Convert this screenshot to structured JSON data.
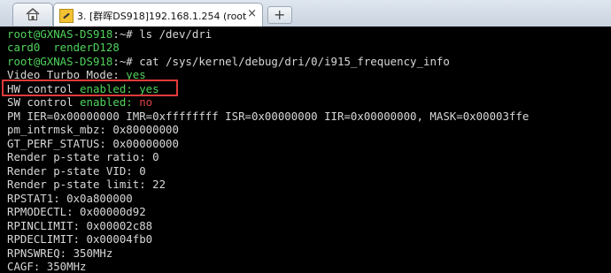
{
  "tabs": {
    "home_icon": "home-icon",
    "session_title": "3. [群晖DS918]192.168.1.254 (root)",
    "close_glyph": "×",
    "new_tab_glyph": "+"
  },
  "terminal": {
    "lines": [
      {
        "prompt": "root@GXNAS-DS918",
        "sep": ":~#",
        "cmd": " ls /dev/dri"
      },
      {
        "out": "card0  renderD128",
        "color": "green"
      },
      {
        "prompt": "root@GXNAS-DS918",
        "sep": ":~#",
        "cmd": " cat /sys/kernel/debug/dri/0/i915_frequency_info"
      },
      {
        "label": "Video Turbo Mode: ",
        "value": "yes",
        "value_color": "green"
      },
      {
        "label": "HW control ",
        "mid": "enabled: ",
        "value": "yes",
        "value_color": "green"
      },
      {
        "label": "SW control ",
        "mid": "enabled: ",
        "value": "no",
        "value_color": "red"
      },
      {
        "out": "PM IER=0x00000000 IMR=0xffffffff ISR=0x00000000 IIR=0x00000000, MASK=0x00003ffe"
      },
      {
        "out": "pm_intrmsk_mbz: 0x80000000"
      },
      {
        "out": "GT_PERF_STATUS: 0x00000000"
      },
      {
        "out": "Render p-state ratio: 0"
      },
      {
        "out": "Render p-state VID: 0"
      },
      {
        "out": "Render p-state limit: 22"
      },
      {
        "out": "RPSTAT1: 0x0a800000"
      },
      {
        "out": "RPMODECTL: 0x00000d92"
      },
      {
        "out": "RPINCLIMIT: 0x00002c88"
      },
      {
        "out": "RPDECLIMIT: 0x00004fb0"
      },
      {
        "out": "RPNSWREQ: 350MHz"
      },
      {
        "out": "CAGF: 350MHz"
      }
    ]
  },
  "highlight": {
    "color": "#e23a3a"
  }
}
